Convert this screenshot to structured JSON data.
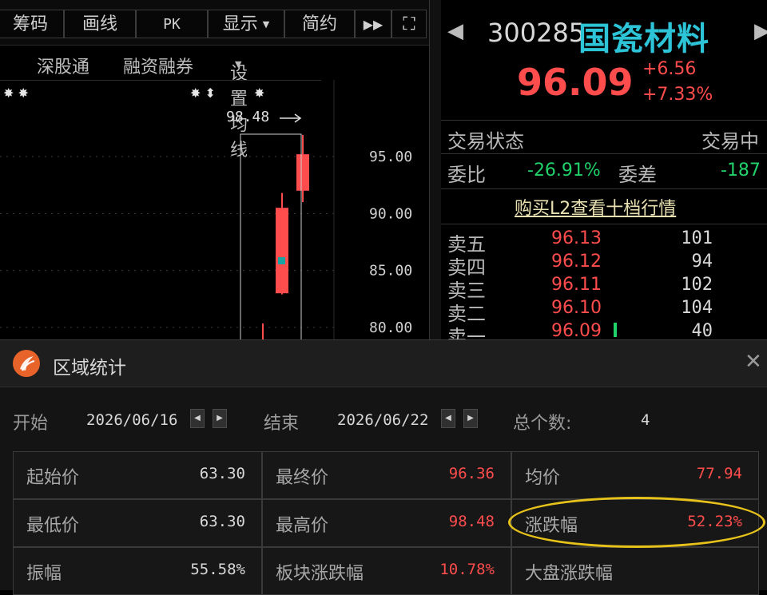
{
  "toolbar": {
    "items": [
      "筹码",
      "画线",
      "PK",
      "显示",
      "简约"
    ],
    "play_icon": "▶▶",
    "expand_icon": "⛶"
  },
  "submenu": {
    "items": [
      "深股通",
      "融资融券",
      "设置均线"
    ]
  },
  "chart": {
    "markers_left": "✸ ✸",
    "markers_right": "✸ ⬍",
    "marker_single": "✸",
    "high_label": "98.48",
    "y_ticks": [
      "95.00",
      "90.00",
      "85.00",
      "80.00"
    ]
  },
  "chart_data": {
    "type": "candlestick",
    "y_ticks": [
      95.0,
      90.0,
      85.0,
      80.0
    ],
    "high_marker": 98.48,
    "candles": [
      {
        "open": 83.0,
        "close": 90.5,
        "high": 91.8,
        "low": 82.9,
        "color": "red"
      },
      {
        "open": 92.0,
        "close": 95.2,
        "high": 96.9,
        "low": 91.0,
        "color": "red"
      }
    ],
    "colors": {
      "up": "#ff4c4c",
      "grid": "#3a3a3a",
      "label": "#d0d0d0"
    }
  },
  "quote": {
    "code": "300285",
    "name": "国瓷材料",
    "price": "96.09",
    "change": "+6.56",
    "change_pct": "+7.33%",
    "trade_status_label": "交易状态",
    "trade_status_value": "交易中",
    "weibi_label": "委比",
    "weibi_value": "-26.91%",
    "weicha_label": "委差",
    "weicha_value": "-187",
    "buy_link": "购买L2查看十档行情"
  },
  "orderbook": [
    {
      "label": "卖五",
      "price": "96.13",
      "vol": "101"
    },
    {
      "label": "卖四",
      "price": "96.12",
      "vol": "94"
    },
    {
      "label": "卖三",
      "price": "96.11",
      "vol": "102"
    },
    {
      "label": "卖二",
      "price": "96.10",
      "vol": "104"
    },
    {
      "label": "卖一",
      "price": "96.09",
      "vol": "40"
    }
  ],
  "dialog": {
    "title": "区域统计",
    "start_label": "开始",
    "start_date": "2026/06/16",
    "end_label": "结束",
    "end_date": "2026/06/22",
    "count_label": "总个数:",
    "count_value": "4",
    "stats": [
      {
        "label": "起始价",
        "value": "63.30",
        "color": "#d8d8d8"
      },
      {
        "label": "最终价",
        "value": "96.36",
        "color": "#ff4c4c"
      },
      {
        "label": "均价",
        "value": "77.94",
        "color": "#ff4c4c"
      },
      {
        "label": "最低价",
        "value": "63.30",
        "color": "#d8d8d8"
      },
      {
        "label": "最高价",
        "value": "98.48",
        "color": "#ff4c4c"
      },
      {
        "label": "涨跌幅",
        "value": "52.23%",
        "color": "#ff4c4c"
      },
      {
        "label": "振幅",
        "value": "55.58%",
        "color": "#d8d8d8"
      },
      {
        "label": "板块涨跌幅",
        "value": "10.78%",
        "color": "#ff4c4c"
      },
      {
        "label": "大盘涨跌幅",
        "value": "",
        "color": "#ff4c4c"
      }
    ]
  }
}
